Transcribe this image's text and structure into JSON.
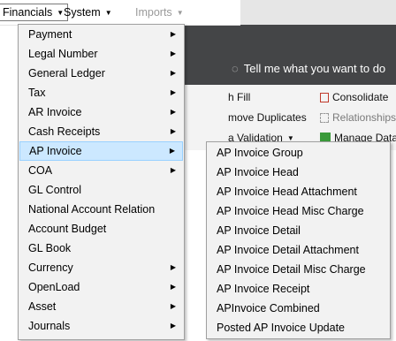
{
  "menubar": {
    "items": [
      {
        "label": "Financials"
      },
      {
        "label": "System"
      },
      {
        "label": "Imports"
      }
    ]
  },
  "background": {
    "tell_me": "Tell me what you want to do",
    "ribbon": {
      "fill": "h Fill",
      "consolidate": "Consolidate",
      "remove_duplicates": "move Duplicates",
      "relationships": "Relationships",
      "data_validation": "a Validation",
      "manage_data": "Manage Data"
    }
  },
  "main_menu": {
    "items": [
      {
        "label": "Payment",
        "has_submenu": true
      },
      {
        "label": "Legal Number",
        "has_submenu": true
      },
      {
        "label": "General Ledger",
        "has_submenu": true
      },
      {
        "label": "Tax",
        "has_submenu": true
      },
      {
        "label": "AR Invoice",
        "has_submenu": true
      },
      {
        "label": "Cash Receipts",
        "has_submenu": true
      },
      {
        "label": "AP Invoice",
        "has_submenu": true
      },
      {
        "label": "COA",
        "has_submenu": true
      },
      {
        "label": "GL Control",
        "has_submenu": false
      },
      {
        "label": "National Account Relation",
        "has_submenu": false
      },
      {
        "label": "Account Budget",
        "has_submenu": false
      },
      {
        "label": "GL Book",
        "has_submenu": false
      },
      {
        "label": "Currency",
        "has_submenu": true
      },
      {
        "label": "OpenLoad",
        "has_submenu": true
      },
      {
        "label": "Asset",
        "has_submenu": true
      },
      {
        "label": "Journals",
        "has_submenu": true
      }
    ]
  },
  "submenu": {
    "items": [
      {
        "label": "AP Invoice Group"
      },
      {
        "label": "AP Invoice Head"
      },
      {
        "label": "AP Invoice Head Attachment"
      },
      {
        "label": "AP Invoice Head Misc Charge"
      },
      {
        "label": "AP Invoice Detail"
      },
      {
        "label": "AP Invoice Detail Attachment"
      },
      {
        "label": "AP Invoice Detail Misc Charge"
      },
      {
        "label": "AP Invoice Receipt"
      },
      {
        "label": "APInvoice Combined"
      },
      {
        "label": "Posted AP Invoice Update"
      }
    ]
  },
  "colors": {
    "highlight": "#cce8ff",
    "highlight_border": "#99d1ff",
    "menu_bg": "#f2f2f2",
    "ribbon_dark": "#444547"
  }
}
